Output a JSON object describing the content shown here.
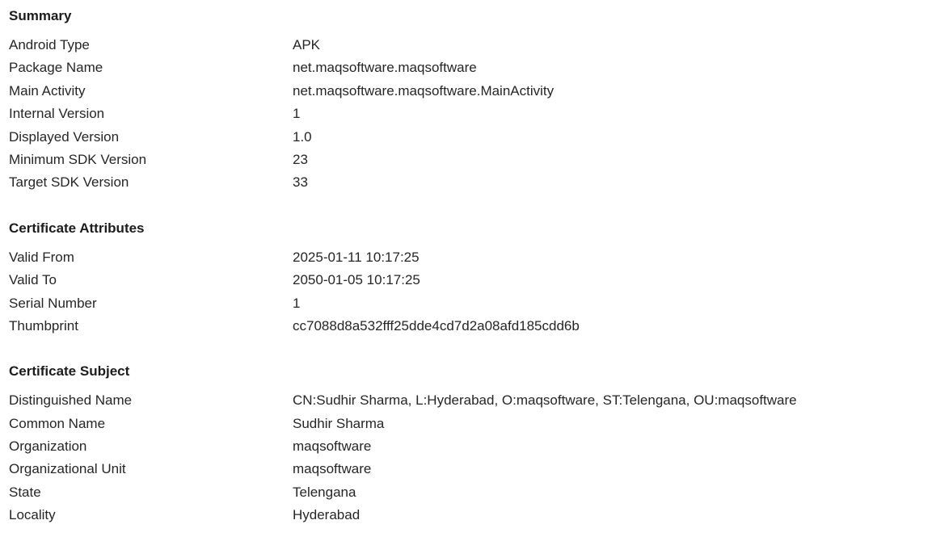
{
  "sections": {
    "summary": {
      "title": "Summary",
      "rows": [
        {
          "label": "Android Type",
          "value": "APK"
        },
        {
          "label": "Package Name",
          "value": "net.maqsoftware.maqsoftware"
        },
        {
          "label": "Main Activity",
          "value": "net.maqsoftware.maqsoftware.MainActivity"
        },
        {
          "label": "Internal Version",
          "value": "1"
        },
        {
          "label": "Displayed Version",
          "value": "1.0"
        },
        {
          "label": "Minimum SDK Version",
          "value": "23"
        },
        {
          "label": "Target SDK Version",
          "value": "33"
        }
      ]
    },
    "certificate_attributes": {
      "title": "Certificate Attributes",
      "rows": [
        {
          "label": "Valid From",
          "value": "2025-01-11 10:17:25"
        },
        {
          "label": "Valid To",
          "value": "2050-01-05 10:17:25"
        },
        {
          "label": "Serial Number",
          "value": "1"
        },
        {
          "label": "Thumbprint",
          "value": "cc7088d8a532fff25dde4cd7d2a08afd185cdd6b"
        }
      ]
    },
    "certificate_subject": {
      "title": "Certificate Subject",
      "rows": [
        {
          "label": "Distinguished Name",
          "value": "CN:Sudhir Sharma, L:Hyderabad, O:maqsoftware, ST:Telengana, OU:maqsoftware"
        },
        {
          "label": "Common Name",
          "value": "Sudhir Sharma"
        },
        {
          "label": "Organization",
          "value": "maqsoftware"
        },
        {
          "label": "Organizational Unit",
          "value": "maqsoftware"
        },
        {
          "label": "State",
          "value": "Telengana"
        },
        {
          "label": "Locality",
          "value": "Hyderabad"
        }
      ]
    }
  }
}
